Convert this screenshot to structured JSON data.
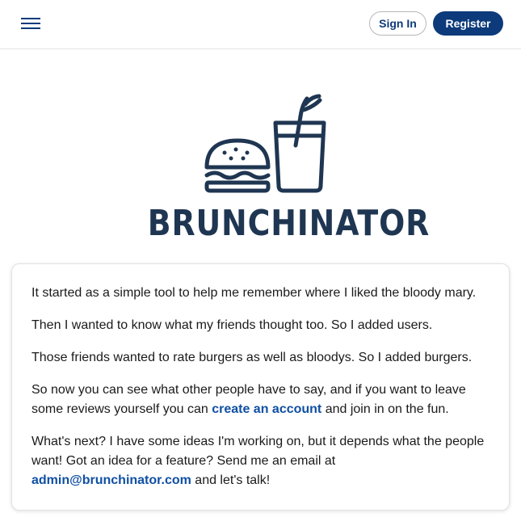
{
  "header": {
    "menu_icon": "hamburger-menu-icon",
    "signin_label": "Sign In",
    "register_label": "Register"
  },
  "logo": {
    "text": "BRUNCHINATOR",
    "icons": [
      "burger-icon",
      "bloody-mary-glass-icon"
    ],
    "color": "#1f3652"
  },
  "about": {
    "p1": "It started as a simple tool to help me remember where I liked the bloody mary.",
    "p2": "Then I wanted to know what my friends thought too. So I added users.",
    "p3": "Those friends wanted to rate burgers as well as bloodys. So I added burgers.",
    "p4_before": "So now you can see what other people have to say, and if you want to leave some reviews yourself you can ",
    "p4_link": "create an account",
    "p4_after": " and join in on the fun.",
    "p5_before": "What's next? I have some ideas I'm working on, but it depends what the people want! Got an idea for a feature? Send me an email at ",
    "p5_link": "admin@brunchinator.com",
    "p5_after": " and let's talk!"
  },
  "colors": {
    "brand_navy": "#0c3a7a",
    "link": "#0f4fa3"
  }
}
